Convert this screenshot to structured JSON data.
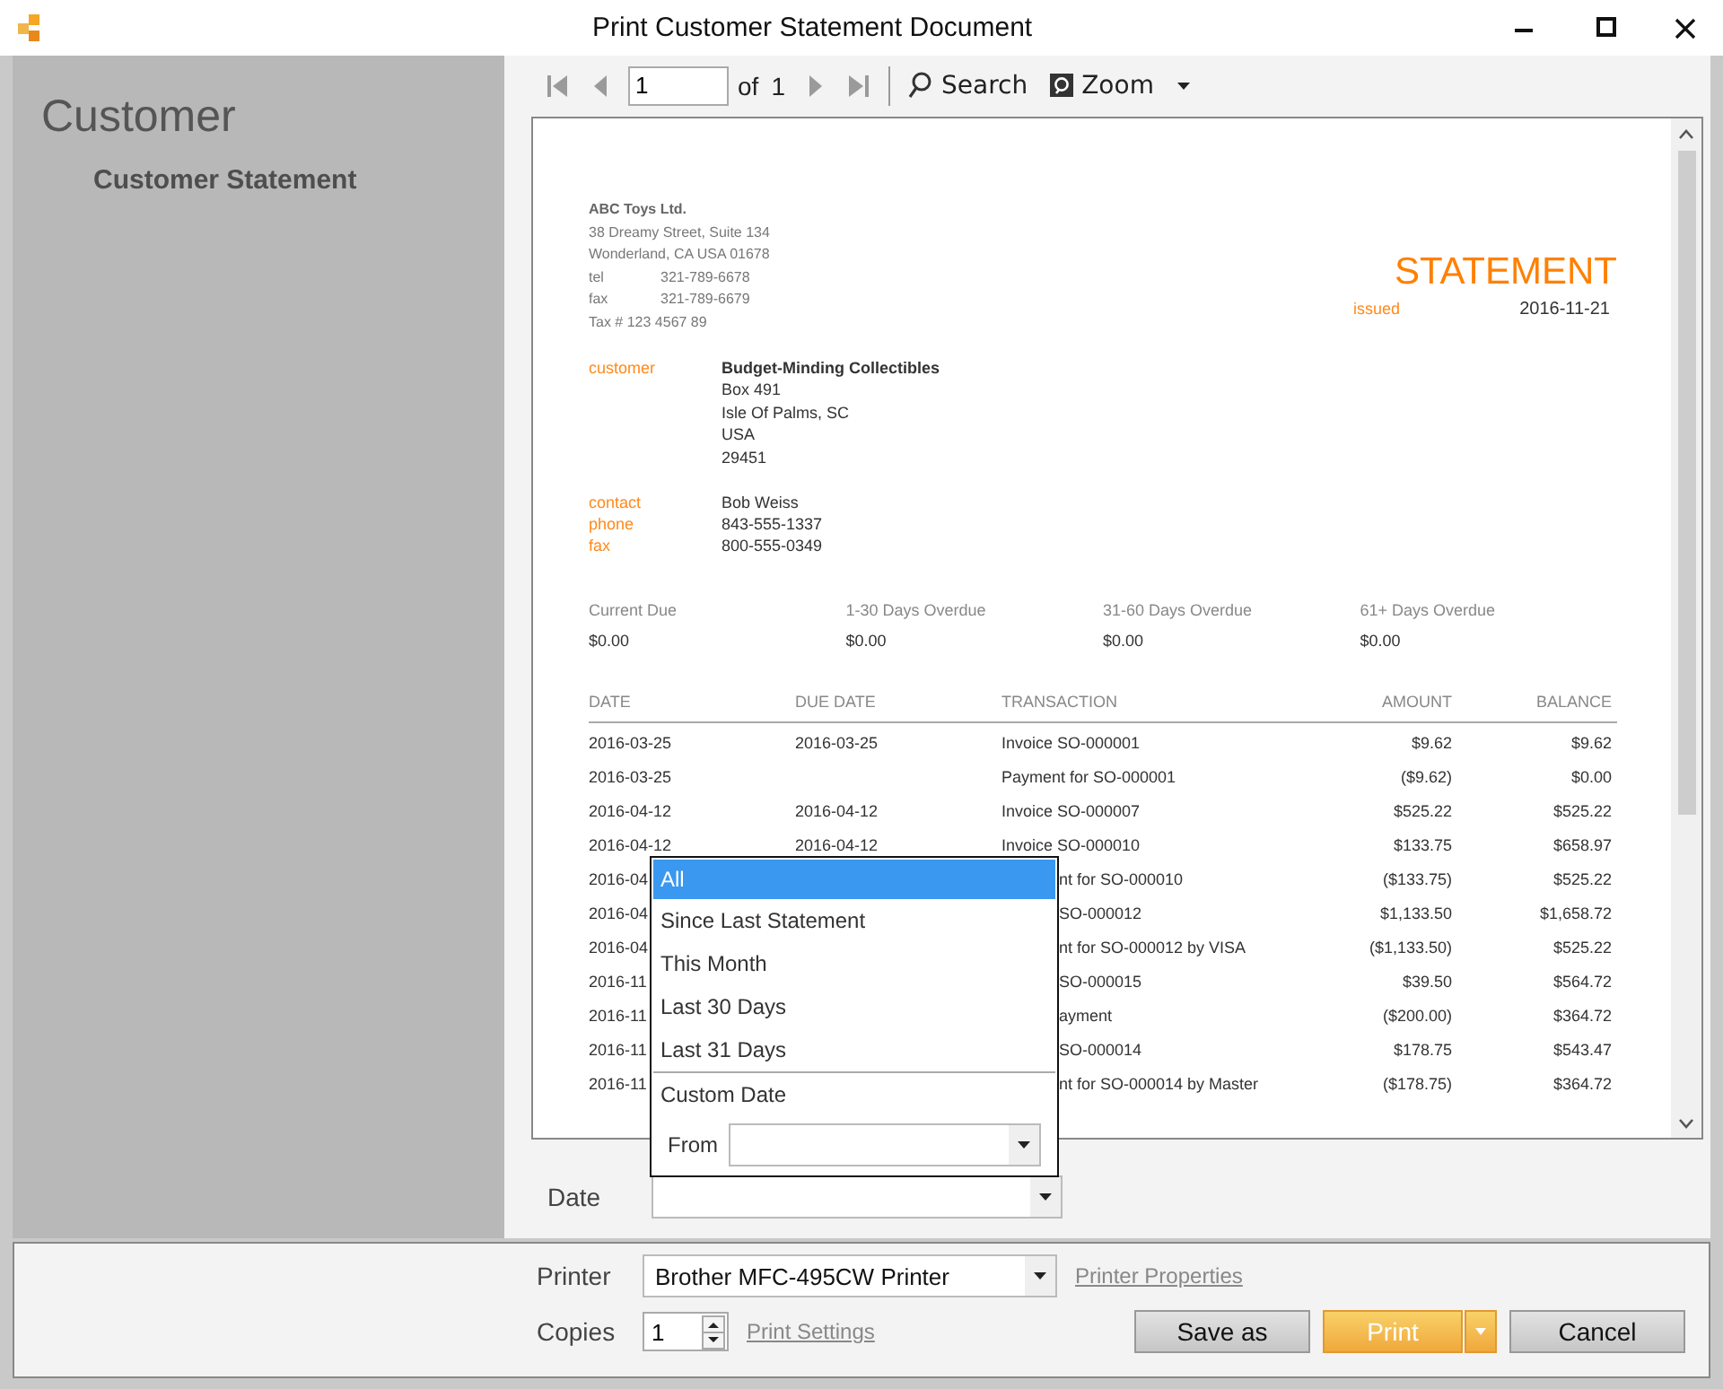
{
  "window": {
    "title": "Print Customer Statement Document"
  },
  "sidebar": {
    "heading": "Customer",
    "items": [
      {
        "label": "Customer Statement",
        "selected": true
      }
    ]
  },
  "toolbar": {
    "page": "1",
    "of_label": "of",
    "page_count": "1",
    "search": "Search",
    "zoom": "Zoom"
  },
  "document": {
    "company": {
      "name": "ABC Toys Ltd.",
      "address": [
        "38 Dreamy Street, Suite 134",
        "Wonderland, CA USA 01678"
      ],
      "phones": [
        {
          "label": "tel",
          "value": "321-789-6678"
        },
        {
          "label": "fax",
          "value": "321-789-6679"
        }
      ],
      "tax": "Tax # 123 4567 89"
    },
    "title": "STATEMENT",
    "issued_label": "issued",
    "issued_date": "2016-11-21",
    "customer_label": "customer",
    "customer_name": "Budget-Minding Collectibles",
    "customer_address": [
      "Box 491",
      "Isle Of Palms, SC",
      "USA",
      "29451"
    ],
    "contacts": [
      {
        "label": "contact",
        "value": "Bob Weiss"
      },
      {
        "label": "phone",
        "value": "843-555-1337"
      },
      {
        "label": "fax",
        "value": "800-555-0349"
      }
    ],
    "aging": [
      {
        "label": "Current Due",
        "value": "$0.00"
      },
      {
        "label": "1-30 Days Overdue",
        "value": "$0.00"
      },
      {
        "label": "31-60 Days Overdue",
        "value": "$0.00"
      },
      {
        "label": "61+ Days Overdue",
        "value": "$0.00"
      }
    ],
    "table": {
      "columns": [
        "DATE",
        "DUE DATE",
        "TRANSACTION",
        "AMOUNT",
        "BALANCE"
      ],
      "rows": [
        {
          "date": "2016-03-25",
          "due_date": "2016-03-25",
          "transaction": "Invoice SO-000001",
          "amount": "$9.62",
          "balance": "$9.62",
          "covered": false
        },
        {
          "date": "2016-03-25",
          "transaction": "Payment for SO-000001",
          "amount": "($9.62)",
          "balance": "$0.00",
          "covered": false
        },
        {
          "date": "2016-04-12",
          "due_date": "2016-04-12",
          "transaction": "Invoice SO-000007",
          "amount": "$525.22",
          "balance": "$525.22",
          "covered": false
        },
        {
          "date": "2016-04-12",
          "due_date": "2016-04-12",
          "transaction": "Invoice SO-000010",
          "amount": "$133.75",
          "balance": "$658.97",
          "covered": false
        },
        {
          "date": "2016-04",
          "transaction": "nt for SO-000010",
          "amount": "($133.75)",
          "balance": "$525.22",
          "covered": true
        },
        {
          "date": "2016-04",
          "transaction": "SO-000012",
          "amount": "$1,133.50",
          "balance": "$1,658.72",
          "covered": true
        },
        {
          "date": "2016-04",
          "transaction": "nt for SO-000012 by VISA",
          "amount": "($1,133.50)",
          "balance": "$525.22",
          "covered": true
        },
        {
          "date": "2016-11",
          "transaction": "SO-000015",
          "amount": "$39.50",
          "balance": "$564.72",
          "covered": true
        },
        {
          "date": "2016-11",
          "transaction": "ayment",
          "amount": "($200.00)",
          "balance": "$364.72",
          "covered": true
        },
        {
          "date": "2016-11",
          "transaction": "SO-000014",
          "amount": "$178.75",
          "balance": "$543.47",
          "covered": true
        },
        {
          "date": "2016-11",
          "transaction": "nt for SO-000014 by Master",
          "amount": "($178.75)",
          "balance": "$364.72",
          "covered": true
        }
      ]
    }
  },
  "date_filter": {
    "label": "Date",
    "expanded": true,
    "options": [
      {
        "label": "All",
        "selected": true
      },
      {
        "label": "Since Last Statement",
        "selected": false
      },
      {
        "label": "This Month",
        "selected": false
      },
      {
        "label": "Last 30 Days",
        "selected": false
      },
      {
        "label": "Last 31 Days",
        "selected": false
      }
    ],
    "custom_label": "Custom Date",
    "from_label": "From"
  },
  "printer": {
    "label": "Printer",
    "value": "Brother MFC-495CW Printer",
    "link": "Printer Properties"
  },
  "copies": {
    "label": "Copies",
    "value": "1",
    "link": "Print Settings"
  },
  "buttons": [
    {
      "label": "Save as",
      "kind": "plain"
    },
    {
      "label": "Print",
      "kind": "primary"
    },
    {
      "label": "Cancel",
      "kind": "plain"
    }
  ]
}
